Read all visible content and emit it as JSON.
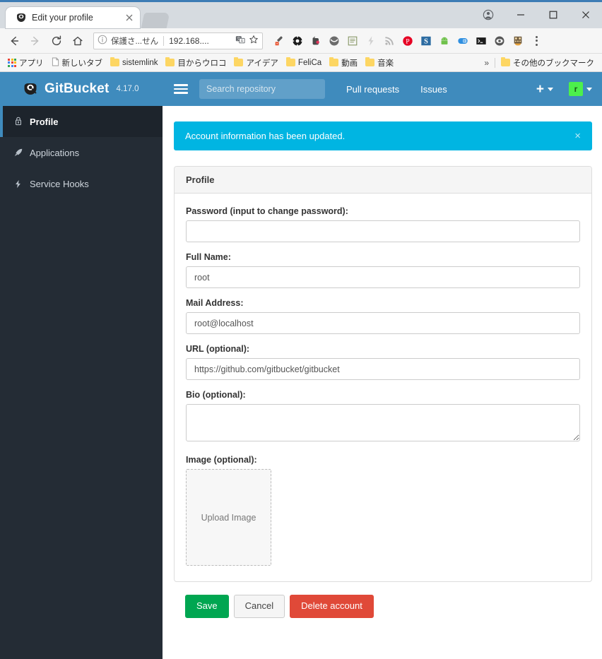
{
  "browser": {
    "tab": {
      "title": "Edit your profile",
      "favicon": "gitbucket-favicon",
      "close": "×"
    },
    "new_tab_label": "+",
    "window_controls": {
      "profile": "account-icon",
      "minimize": "—",
      "maximize": "□",
      "close": "✕"
    },
    "nav": {
      "back": "←",
      "forward": "→",
      "reload": "⟳",
      "home": "⌂"
    },
    "omnibox": {
      "security_text": "保護さ...せん",
      "url": "192.168....",
      "info_icon": "info-circle-icon",
      "translate_icon": "translate-icon",
      "star_icon": "star-icon"
    },
    "extensions": [
      {
        "name": "eyedropper-extension-icon"
      },
      {
        "name": "settings-gear-extension-icon"
      },
      {
        "name": "evernote-extension-icon"
      },
      {
        "name": "pocket-extension-icon"
      },
      {
        "name": "reader-extension-icon"
      },
      {
        "name": "lightning-extension-icon"
      },
      {
        "name": "rss-extension-icon"
      },
      {
        "name": "pinterest-extension-icon"
      },
      {
        "name": "s-extension-icon"
      },
      {
        "name": "android-extension-icon"
      },
      {
        "name": "bluetooth-card-extension-icon"
      },
      {
        "name": "terminal-extension-icon"
      },
      {
        "name": "eye-extension-icon"
      },
      {
        "name": "qr-extension-icon"
      }
    ],
    "menu_icon": "three-dots-menu-icon",
    "bookmarks": {
      "apps_label": "アプリ",
      "items": [
        {
          "label": "新しいタブ",
          "icon": "page-icon"
        },
        {
          "label": "sistemlink",
          "icon": "folder-icon"
        },
        {
          "label": "目からウロコ",
          "icon": "folder-icon"
        },
        {
          "label": "アイデア",
          "icon": "folder-icon"
        },
        {
          "label": "FeliCa",
          "icon": "folder-icon"
        },
        {
          "label": "動画",
          "icon": "folder-icon"
        },
        {
          "label": "音楽",
          "icon": "folder-icon"
        }
      ],
      "overflow": "»",
      "other_bookmarks": {
        "label": "その他のブックマーク",
        "icon": "folder-icon"
      }
    }
  },
  "app": {
    "brand": {
      "name": "GitBucket",
      "version": "4.17.0",
      "logo": "gitbucket-logo-icon"
    },
    "topnav": {
      "menu_icon": "hamburger-icon",
      "search_placeholder": "Search repository",
      "search_value": "",
      "links": [
        {
          "label": "Pull requests"
        },
        {
          "label": "Issues"
        }
      ],
      "create_icon": "plus-icon",
      "avatar_initial": "r"
    },
    "sidebar": {
      "items": [
        {
          "label": "Profile",
          "icon": "key-icon",
          "active": true
        },
        {
          "label": "Applications",
          "icon": "rocket-icon",
          "active": false
        },
        {
          "label": "Service Hooks",
          "icon": "zap-icon",
          "active": false
        }
      ]
    },
    "alert": {
      "message": "Account information has been updated.",
      "close": "×",
      "color": "#00b5e2"
    },
    "panel": {
      "title": "Profile",
      "fields": [
        {
          "label": "Password (input to change password):",
          "value": "",
          "placeholder": "",
          "type": "password"
        },
        {
          "label": "Full Name:",
          "value": "root",
          "placeholder": "",
          "type": "text"
        },
        {
          "label": "Mail Address:",
          "value": "root@localhost",
          "placeholder": "",
          "type": "text"
        },
        {
          "label": "URL (optional):",
          "value": "https://github.com/gitbucket/gitbucket",
          "placeholder": "",
          "type": "text"
        },
        {
          "label": "Bio (optional):",
          "value": "",
          "placeholder": "",
          "type": "textarea"
        },
        {
          "label": "Image (optional):",
          "value": "Upload Image",
          "placeholder": "",
          "type": "upload"
        }
      ]
    },
    "buttons": {
      "save": "Save",
      "cancel": "Cancel",
      "delete_account": "Delete account",
      "save_color": "#00a651",
      "delete_color": "#e04938"
    }
  }
}
